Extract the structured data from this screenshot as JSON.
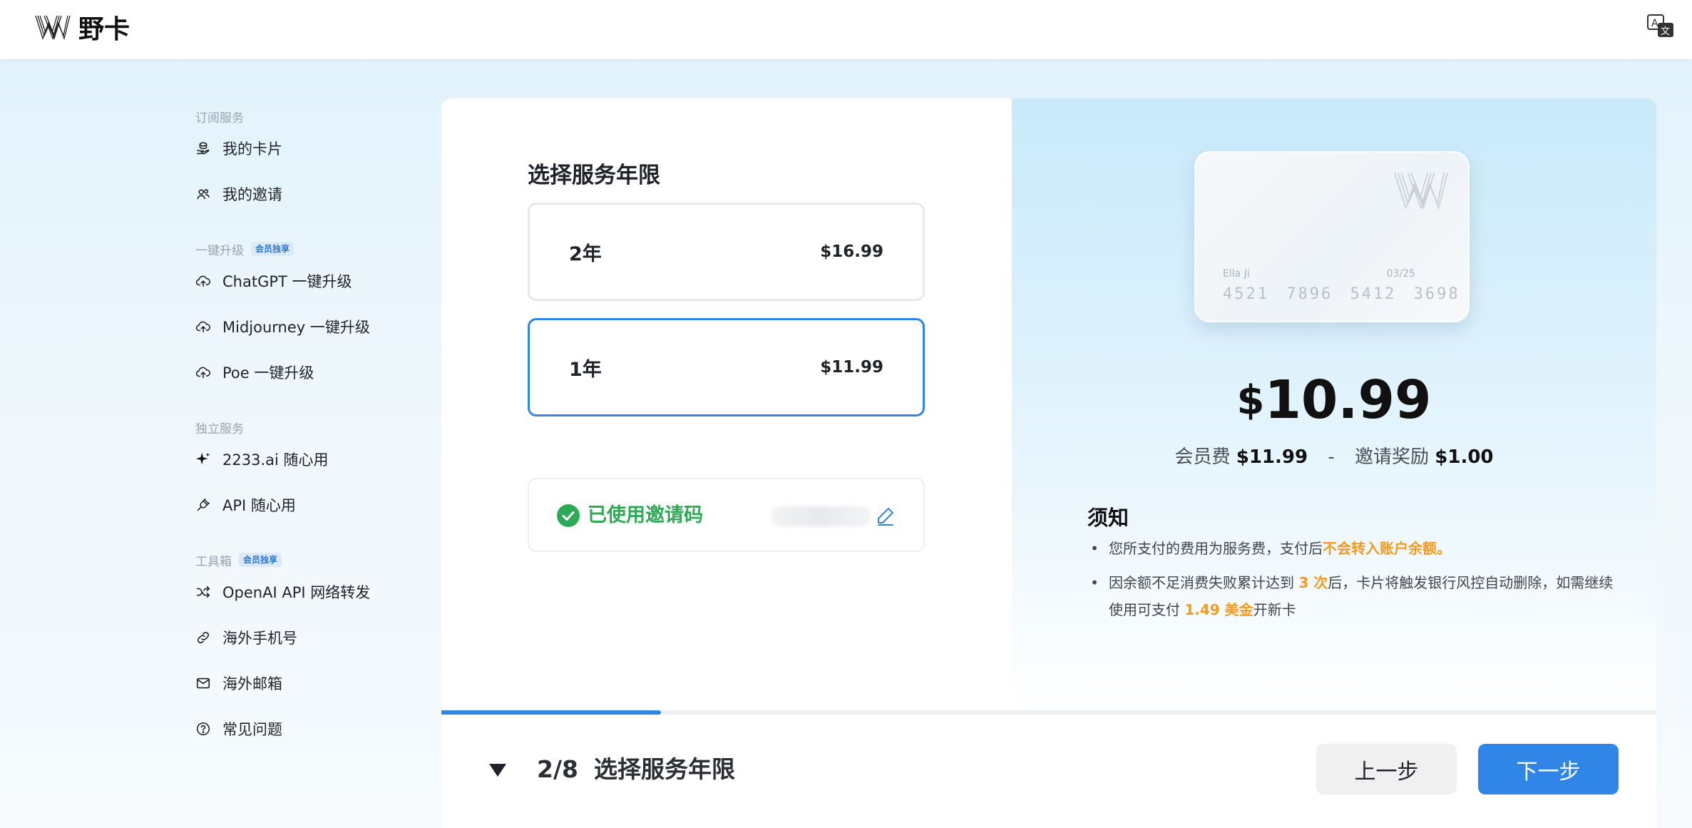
{
  "header": {
    "brand": "野卡",
    "language_icon": "translate-icon"
  },
  "sidebar": {
    "groups": [
      {
        "title": "订阅服务",
        "badge": "",
        "items": [
          {
            "label": "我的卡片",
            "icon": "wallet-icon"
          },
          {
            "label": "我的邀请",
            "icon": "users-icon"
          }
        ]
      },
      {
        "title": "一键升级",
        "badge": "会员独享",
        "items": [
          {
            "label": "ChatGPT 一键升级",
            "icon": "cloud-upload-icon"
          },
          {
            "label": "Midjourney 一键升级",
            "icon": "cloud-upload-icon"
          },
          {
            "label": "Poe 一键升级",
            "icon": "cloud-upload-icon"
          }
        ]
      },
      {
        "title": "独立服务",
        "badge": "",
        "items": [
          {
            "label": "2233.ai 随心用",
            "icon": "sparkle-icon"
          },
          {
            "label": "API 随心用",
            "icon": "plug-icon"
          }
        ]
      },
      {
        "title": "工具箱",
        "badge": "会员独享",
        "items": [
          {
            "label": "OpenAI API 网络转发",
            "icon": "shuffle-icon"
          },
          {
            "label": "海外手机号",
            "icon": "link-icon"
          },
          {
            "label": "海外邮箱",
            "icon": "mail-icon"
          },
          {
            "label": "常见问题",
            "icon": "help-circle-icon"
          }
        ]
      }
    ]
  },
  "plan": {
    "title": "选择服务年限",
    "options": [
      {
        "label": "2年",
        "price": "$16.99",
        "selected": false
      },
      {
        "label": "1年",
        "price": "$11.99",
        "selected": true
      }
    ],
    "invite_status": "已使用邀请码"
  },
  "card": {
    "holder": "Ella Ji",
    "expiry": "03/25",
    "number": "4521 7896 5412 3698"
  },
  "price": {
    "currency": "$",
    "amount": "10.99",
    "fee_label": "会员费",
    "fee_value": "$11.99",
    "separator": "-",
    "reward_label": "邀请奖励",
    "reward_value": "$1.00"
  },
  "notice": {
    "title": "须知",
    "items": [
      {
        "parts": [
          "您所支付的费用为服务费，支付后",
          "不会转入账户余额。"
        ]
      },
      {
        "parts": [
          "因余额不足消费失败累计达到 ",
          "3 次",
          "后，卡片将触发银行风控自动删除，如需继续使用可支付 ",
          "1.49 美金",
          "开新卡"
        ]
      }
    ]
  },
  "progress": {
    "current_step": 2,
    "total_steps": 8,
    "fraction": 0.25,
    "step_label": "2/8",
    "step_name": "选择服务年限"
  },
  "footer": {
    "prev_label": "上一步",
    "next_label": "下一步"
  },
  "colors": {
    "accent": "#2f86e6",
    "success": "#2daa55",
    "warning": "#f39a1f"
  }
}
